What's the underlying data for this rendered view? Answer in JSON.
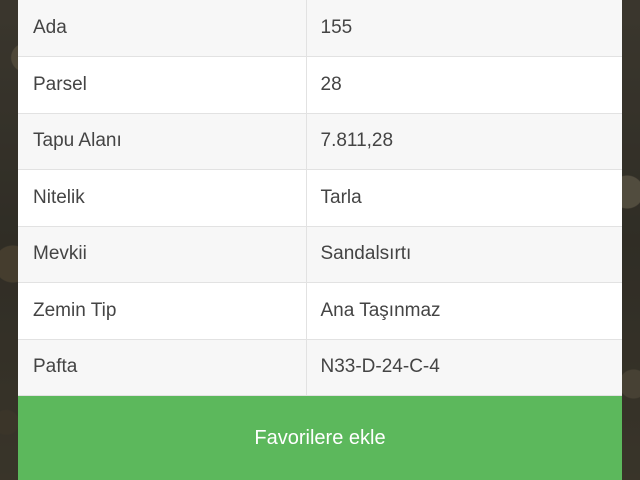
{
  "parcel_info": {
    "rows": [
      {
        "label": "Ada",
        "value": "155"
      },
      {
        "label": "Parsel",
        "value": "28"
      },
      {
        "label": "Tapu Alanı",
        "value": "7.811,28"
      },
      {
        "label": "Nitelik",
        "value": "Tarla"
      },
      {
        "label": "Mevkii",
        "value": "Sandalsırtı"
      },
      {
        "label": "Zemin Tip",
        "value": "Ana Taşınmaz"
      },
      {
        "label": "Pafta",
        "value": "N33-D-24-C-4"
      }
    ]
  },
  "actions": {
    "favorite_label": "Favorilere ekle"
  },
  "colors": {
    "button": "#5cb85c"
  }
}
